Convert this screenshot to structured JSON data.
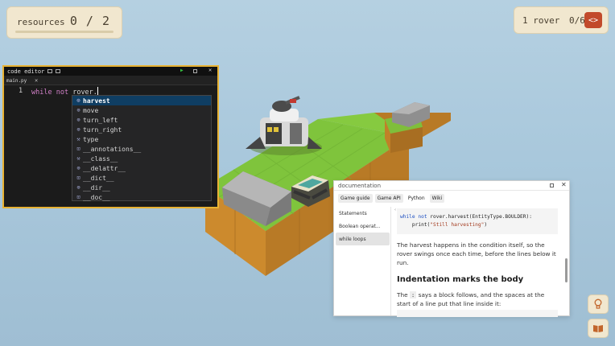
{
  "hud": {
    "resources_label": "resources",
    "resources_count": "0 / 2",
    "rover_label": "1 rover",
    "rover_count": "0/6",
    "code_button": "<>"
  },
  "editor": {
    "title": "code editor",
    "tab": "main.py",
    "line_number": "1",
    "code_keyword1": "while",
    "code_keyword2": "not",
    "code_text": "rover.",
    "autocomplete": [
      {
        "label": "harvest",
        "icon": "method-icon"
      },
      {
        "label": "move",
        "icon": "method-icon"
      },
      {
        "label": "turn_left",
        "icon": "method-icon"
      },
      {
        "label": "turn_right",
        "icon": "method-icon"
      },
      {
        "label": "type",
        "icon": "wrench-icon"
      },
      {
        "label": "__annotations__",
        "icon": "field-icon"
      },
      {
        "label": "__class__",
        "icon": "wrench-icon"
      },
      {
        "label": "__delattr__",
        "icon": "method-icon"
      },
      {
        "label": "__dict__",
        "icon": "field-icon"
      },
      {
        "label": "__dir__",
        "icon": "method-icon"
      },
      {
        "label": "__doc__",
        "icon": "field-icon"
      }
    ]
  },
  "docs": {
    "title": "documentation",
    "tabs": [
      "Game guide",
      "Game API",
      "Python",
      "Wiki"
    ],
    "sidebar": [
      "Statements",
      "Boolean operat...",
      "while loops"
    ],
    "code_while": "while",
    "code_not": "not",
    "code_line1_rest": "rover.harvest(EntityType.BOULDER):",
    "code_print": "print(",
    "code_str": "\"Still harvesting\"",
    "code_close": ")",
    "para1": "The harvest happens in the condition itself, so the rover swings once each time, before the lines below it run.",
    "heading": "Indentation marks the body",
    "para2_pre": "The",
    "para2_code": ":",
    "para2_post": "says a block follows, and the spaces at the start of a line put that line inside it:"
  },
  "colors": {
    "accent": "#e8b233",
    "hud_bg": "#f1e7cf",
    "code_button": "#c24a2b",
    "grass": "#7ec23b",
    "dirt": "#c6862e"
  }
}
